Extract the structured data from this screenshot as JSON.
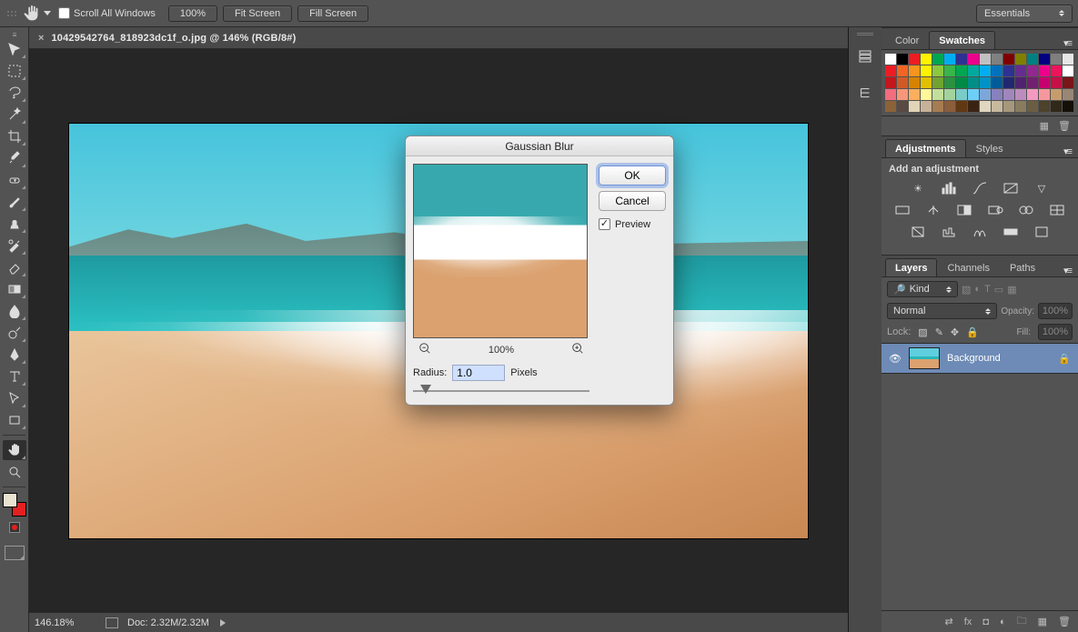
{
  "option_bar": {
    "scroll_all_label": "Scroll All Windows",
    "zoom_100": "100%",
    "fit_screen": "Fit Screen",
    "fill_screen": "Fill Screen",
    "workspace": "Essentials"
  },
  "document": {
    "tab_title": "10429542764_818923dc1f_o.jpg @ 146% (RGB/8#)"
  },
  "status": {
    "zoom": "146.18%",
    "doc_info": "Doc: 2.32M/2.32M"
  },
  "dialog": {
    "title": "Gaussian Blur",
    "ok": "OK",
    "cancel": "Cancel",
    "preview_label": "Preview",
    "preview_checked": true,
    "zoom_label": "100%",
    "radius_label": "Radius:",
    "radius_value": "1.0",
    "radius_unit": "Pixels"
  },
  "panels": {
    "color_tab": "Color",
    "swatches_tab": "Swatches",
    "adjustments_tab": "Adjustments",
    "styles_tab": "Styles",
    "add_adjustment_label": "Add an adjustment",
    "layers_tab": "Layers",
    "channels_tab": "Channels",
    "paths_tab": "Paths",
    "kind_label": "Kind",
    "blend_mode": "Normal",
    "opacity_label": "Opacity:",
    "opacity_value": "100%",
    "lock_label": "Lock:",
    "fill_label": "Fill:",
    "fill_value": "100%",
    "layer_name": "Background"
  },
  "swatches": [
    "#ffffff",
    "#000000",
    "#ec1c24",
    "#fff200",
    "#00a651",
    "#00aeef",
    "#2e3192",
    "#ec008c",
    "#c0c0c0",
    "#808080",
    "#800000",
    "#808000",
    "#008080",
    "#000080",
    "#7f7f7f",
    "#e6e6e6",
    "#ed1c24",
    "#f26522",
    "#f7941d",
    "#fff200",
    "#8dc63f",
    "#39b54a",
    "#00a651",
    "#00a99d",
    "#00aeef",
    "#0072bc",
    "#2e3192",
    "#662d91",
    "#92278f",
    "#ec008c",
    "#ed145b",
    "#ffffff",
    "#c4161c",
    "#cf5a28",
    "#d68300",
    "#e0c000",
    "#72a230",
    "#2c9140",
    "#008a45",
    "#008e86",
    "#0092c7",
    "#005b97",
    "#222770",
    "#4f2270",
    "#71206f",
    "#c7006f",
    "#c70f47",
    "#7a1518",
    "#f26d7d",
    "#f7977a",
    "#fbaf5d",
    "#fff799",
    "#c4df9b",
    "#a3d39c",
    "#7accc8",
    "#6dcff6",
    "#7da7d9",
    "#8781bd",
    "#a186be",
    "#bd8cbf",
    "#f49ac1",
    "#f5989d",
    "#c69c6d",
    "#998675",
    "#8c6239",
    "#594a42",
    "#e2d5b7",
    "#c7b299",
    "#a67c52",
    "#8b5e3c",
    "#603913",
    "#3b2314",
    "#e0d7c0",
    "#c7b89e",
    "#a6987b",
    "#897b5e",
    "#6b5e42",
    "#4d422b",
    "#302818",
    "#141007"
  ]
}
